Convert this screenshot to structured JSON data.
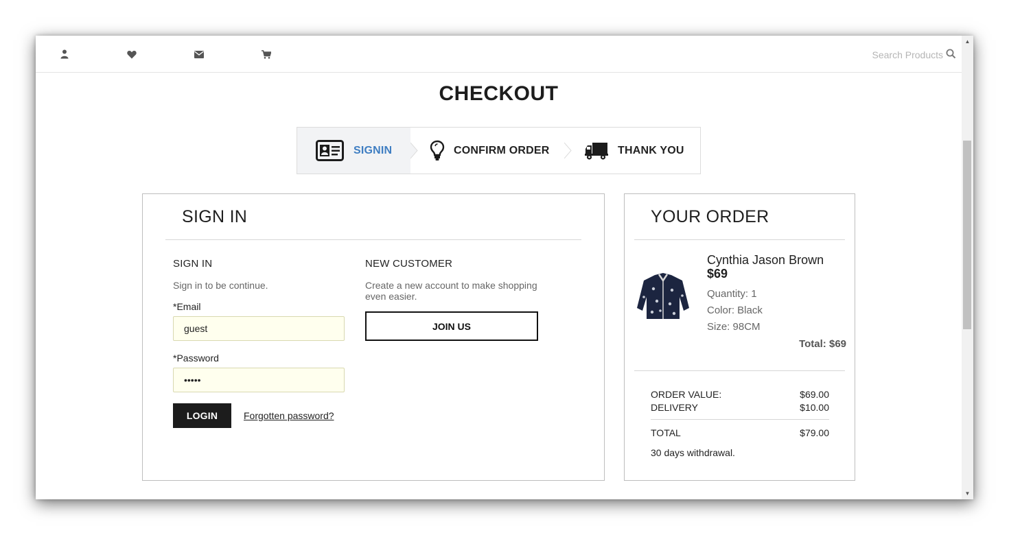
{
  "header": {
    "icons": [
      "user-icon",
      "heart-icon",
      "envelope-icon",
      "cart-icon"
    ],
    "search_placeholder": "Search Products"
  },
  "page": {
    "title": "CHECKOUT"
  },
  "steps": [
    {
      "label": "SIGNIN",
      "icon": "id-card-icon",
      "active": true
    },
    {
      "label": "CONFIRM ORDER",
      "icon": "lightbulb-icon",
      "active": false
    },
    {
      "label": "THANK YOU",
      "icon": "truck-icon",
      "active": false
    }
  ],
  "signin": {
    "title": "SIGN IN",
    "returning": {
      "heading": "SIGN IN",
      "subtitle": "Sign in to be continue.",
      "email_label": "*Email",
      "email_value": "guest",
      "password_label": "*Password",
      "password_value": "guest",
      "login_label": "LOGIN",
      "forgot_label": "Forgotten password?"
    },
    "new_customer": {
      "heading": "NEW CUSTOMER",
      "text_line1": "Create a new account to make shopping",
      "text_line2": "even easier.",
      "join_label": "JOIN US"
    }
  },
  "order": {
    "title": "YOUR ORDER",
    "item": {
      "name": "Cynthia Jason Brown",
      "price": "$69",
      "quantity": "Quantity: 1",
      "color": "Color: Black",
      "size": "Size: 98CM",
      "total": "Total: $69"
    },
    "summary": {
      "order_value_label": "ORDER VALUE:",
      "order_value": "$69.00",
      "delivery_label": "DELIVERY",
      "delivery": "$10.00",
      "total_label": "TOTAL",
      "total": "$79.00"
    },
    "note": "30 days withdrawal."
  },
  "colors": {
    "accent": "#3f7ec2",
    "button_dark": "#1c1c1c",
    "input_bg": "#ffffee"
  }
}
